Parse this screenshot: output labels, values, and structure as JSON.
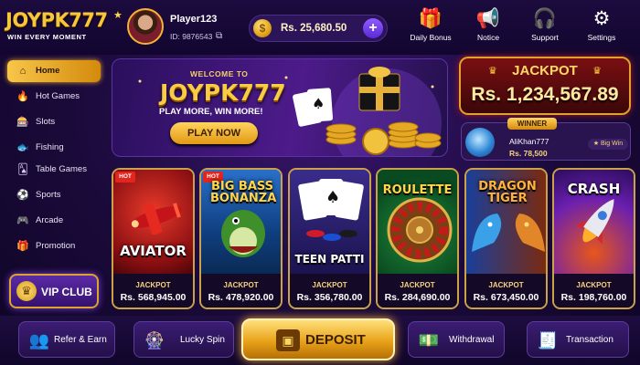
{
  "brand": {
    "name": "JOYPK777",
    "tagline": "WIN EVERY MOMENT"
  },
  "player": {
    "name": "Player123",
    "id": "ID: 9876543"
  },
  "balance": {
    "amount": "Rs. 25,680.50",
    "add_label": "+"
  },
  "top_actions": [
    {
      "label": "Daily Bonus",
      "icon": "gift-icon"
    },
    {
      "label": "Notice",
      "icon": "megaphone-icon"
    },
    {
      "label": "Support",
      "icon": "headset-icon"
    },
    {
      "label": "Settings",
      "icon": "gear-icon"
    }
  ],
  "sidebar": {
    "items": [
      {
        "label": "Home",
        "icon": "home-icon",
        "active": true
      },
      {
        "label": "Hot Games",
        "icon": "flame-icon"
      },
      {
        "label": "Slots",
        "icon": "slot-machine-icon"
      },
      {
        "label": "Fishing",
        "icon": "fish-icon"
      },
      {
        "label": "Table Games",
        "icon": "cards-icon"
      },
      {
        "label": "Sports",
        "icon": "soccer-ball-icon"
      },
      {
        "label": "Arcade",
        "icon": "gamepad-icon"
      },
      {
        "label": "Promotion",
        "icon": "gift-icon"
      }
    ],
    "vip_label": "VIP CLUB"
  },
  "banner": {
    "welcome": "WELCOME TO",
    "brand": "JOYPK777",
    "tagline": "PLAY MORE, WIN MORE!",
    "cta": "PLAY NOW"
  },
  "jackpot": {
    "title": "JACKPOT",
    "value": "Rs. 1,234,567.89"
  },
  "winner": {
    "tag": "WINNER",
    "name": "AliKhan777",
    "amount": "Rs. 78,500",
    "badge": "Big Win"
  },
  "games": [
    {
      "title": "AVIATOR",
      "hot": true,
      "jackpot_label": "JACKPOT",
      "jackpot": "Rs. 568,945.00"
    },
    {
      "title": "BIG BASS BONANZA",
      "hot": true,
      "jackpot_label": "JACKPOT",
      "jackpot": "Rs. 478,920.00"
    },
    {
      "title": "TEEN PATTI",
      "hot": false,
      "jackpot_label": "JACKPOT",
      "jackpot": "Rs. 356,780.00"
    },
    {
      "title": "ROULETTE",
      "hot": false,
      "jackpot_label": "JACKPOT",
      "jackpot": "Rs. 284,690.00"
    },
    {
      "title": "DRAGON TIGER",
      "hot": false,
      "jackpot_label": "JACKPOT",
      "jackpot": "Rs. 673,450.00"
    },
    {
      "title": "CRASH",
      "hot": false,
      "jackpot_label": "JACKPOT",
      "jackpot": "Rs. 198,760.00"
    }
  ],
  "hot_badge": "HOT",
  "bottom_nav": {
    "refer": "Refer & Earn",
    "spin": "Lucky Spin",
    "deposit": "DEPOSIT",
    "withdrawal": "Withdrawal",
    "transaction": "Transaction"
  }
}
